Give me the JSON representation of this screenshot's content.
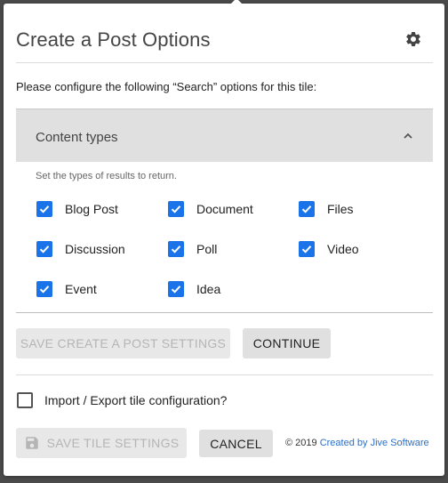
{
  "dialog": {
    "title": "Create a Post Options",
    "intro": "Please configure the following “Search” options for this tile:"
  },
  "content_types": {
    "header": "Content types",
    "hint": "Set the types of results to return.",
    "options": [
      {
        "label": "Blog Post",
        "checked": true
      },
      {
        "label": "Document",
        "checked": true
      },
      {
        "label": "Files",
        "checked": true
      },
      {
        "label": "Discussion",
        "checked": true
      },
      {
        "label": "Poll",
        "checked": true
      },
      {
        "label": "Video",
        "checked": true
      },
      {
        "label": "Event",
        "checked": true
      },
      {
        "label": "Idea",
        "checked": true
      }
    ]
  },
  "buttons": {
    "save_create_post": "SAVE CREATE A POST SETTINGS",
    "continue": "CONTINUE",
    "save_tile": "SAVE TILE SETTINGS",
    "cancel": "CANCEL"
  },
  "import_export": {
    "label": "Import / Export tile configuration?",
    "checked": false
  },
  "footer": {
    "copyright": "© 2019",
    "link_text": "Created by Jive Software"
  },
  "colors": {
    "checkbox": "#1a73e8",
    "link": "#2a6fc9",
    "section_bg": "#e0e0e0"
  }
}
